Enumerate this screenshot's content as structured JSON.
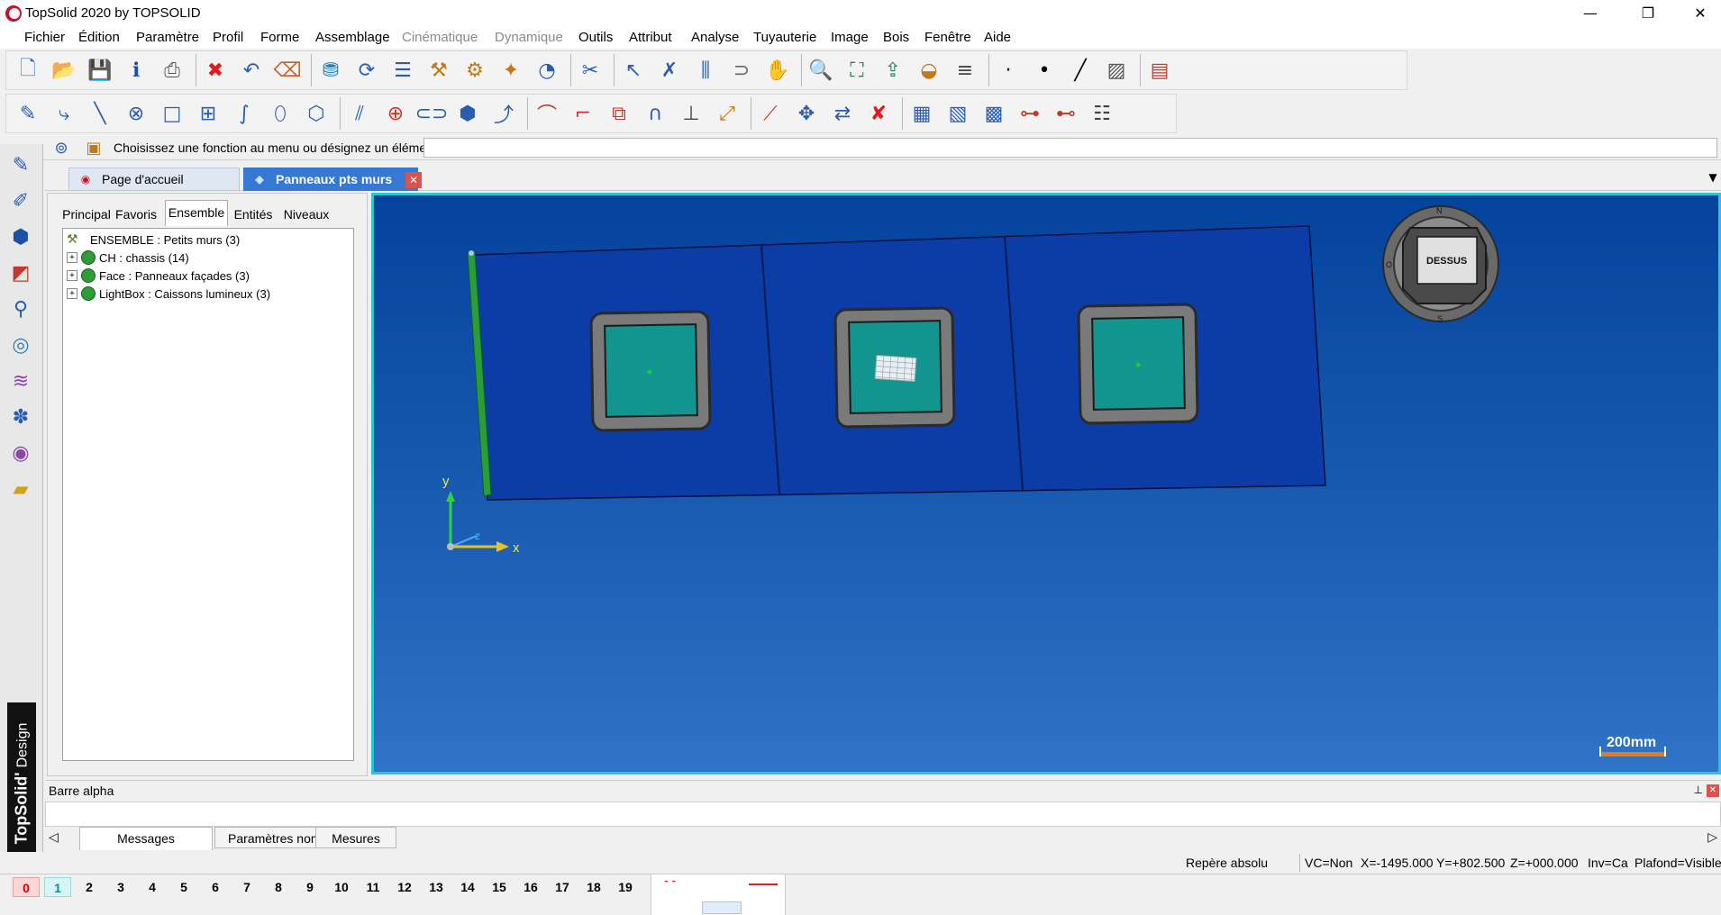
{
  "window": {
    "title": "TopSolid 2020 by TOPSOLID",
    "minimize_glyph": "—",
    "maximize_glyph": "❐",
    "close_glyph": "✕"
  },
  "menu": [
    {
      "label": "Fichier",
      "enabled": true
    },
    {
      "label": "Édition",
      "enabled": true
    },
    {
      "label": "Paramètre",
      "enabled": true
    },
    {
      "label": "Profil",
      "enabled": true
    },
    {
      "label": "Forme",
      "enabled": true
    },
    {
      "label": "Assemblage",
      "enabled": true
    },
    {
      "label": "Cinématique",
      "enabled": false
    },
    {
      "label": "Dynamique",
      "enabled": false
    },
    {
      "label": "Outils",
      "enabled": true
    },
    {
      "label": "Attribut",
      "enabled": true
    },
    {
      "label": "Analyse",
      "enabled": true
    },
    {
      "label": "Tuyauterie",
      "enabled": true
    },
    {
      "label": "Image",
      "enabled": true
    },
    {
      "label": "Bois",
      "enabled": true
    },
    {
      "label": "Fenêtre",
      "enabled": true
    },
    {
      "label": "Aide",
      "enabled": true
    }
  ],
  "toolbar1": {
    "icons": [
      {
        "name": "new-document-icon",
        "glyph": "🗋",
        "color": "#3a6fc4"
      },
      {
        "name": "open-folder-icon",
        "glyph": "📂",
        "color": "#d4a017"
      },
      {
        "name": "save-icon",
        "glyph": "💾",
        "color": "#2a4a8c"
      },
      {
        "name": "document-info-icon",
        "glyph": "ℹ",
        "color": "#1b4fa8"
      },
      {
        "name": "print-icon",
        "glyph": "⎙",
        "color": "#555555"
      },
      {
        "name": "delete-icon",
        "glyph": "✖",
        "color": "#e01b1b"
      },
      {
        "name": "undo-icon",
        "glyph": "↶",
        "color": "#2a5db0"
      },
      {
        "name": "eraser-icon",
        "glyph": "⌫",
        "color": "#c0622a"
      },
      {
        "name": "filter-icon",
        "glyph": "⛃",
        "color": "#2a7fbf"
      },
      {
        "name": "rotate-view-icon",
        "glyph": "⟳",
        "color": "#2a5db0"
      },
      {
        "name": "settings-sliders-icon",
        "glyph": "☰",
        "color": "#2a5db0"
      },
      {
        "name": "hammer-icon",
        "glyph": "⚒",
        "color": "#c07a1a"
      },
      {
        "name": "tools-icon",
        "glyph": "⚙",
        "color": "#c07a1a"
      },
      {
        "name": "magic-icon",
        "glyph": "✦",
        "color": "#c07a1a"
      },
      {
        "name": "measure-icon",
        "glyph": "◔",
        "color": "#2a5db0"
      },
      {
        "name": "snap-icon",
        "glyph": "✂",
        "color": "#2a5db0"
      },
      {
        "name": "select-arrow-icon",
        "glyph": "↖",
        "color": "#2a5db0"
      },
      {
        "name": "pick-icon",
        "glyph": "✗",
        "color": "#2a5db0"
      },
      {
        "name": "columns-icon",
        "glyph": "⫼",
        "color": "#2a5db0"
      },
      {
        "name": "magnet-icon",
        "glyph": "⊃",
        "color": "#666666"
      },
      {
        "name": "hand-icon",
        "glyph": "✋",
        "color": "#444444"
      },
      {
        "name": "zoom-icon",
        "glyph": "🔍",
        "color": "#2a5db0"
      },
      {
        "name": "fit-view-icon",
        "glyph": "⛶",
        "color": "#2a7f4f"
      },
      {
        "name": "export-icon",
        "glyph": "⇪",
        "color": "#2a7f4f"
      },
      {
        "name": "display-mode-icon",
        "glyph": "◒",
        "color": "#c07a1a"
      },
      {
        "name": "layer-icon",
        "glyph": "≡",
        "color": "#444444"
      },
      {
        "name": "dot-small-icon",
        "glyph": "·",
        "color": "#000000"
      },
      {
        "name": "dot-large-icon",
        "glyph": "•",
        "color": "#000000"
      },
      {
        "name": "line-icon",
        "glyph": "╱",
        "color": "#000000"
      },
      {
        "name": "hatch-icon",
        "glyph": "▨",
        "color": "#555555"
      },
      {
        "name": "screen-icon",
        "glyph": "▤",
        "color": "#c0392b"
      }
    ]
  },
  "toolbar2": {
    "icons": [
      {
        "name": "sketch-pencil-icon",
        "glyph": "✎",
        "color": "#2a5db0"
      },
      {
        "name": "polyline-icon",
        "glyph": "⤷",
        "color": "#2a5db0"
      },
      {
        "name": "line-tool-icon",
        "glyph": "╲",
        "color": "#2a5db0"
      },
      {
        "name": "circle-center-icon",
        "glyph": "⊗",
        "color": "#2a5db0"
      },
      {
        "name": "rectangle-icon",
        "glyph": "□",
        "color": "#2a5db0"
      },
      {
        "name": "frame-icon",
        "glyph": "⊞",
        "color": "#2a5db0"
      },
      {
        "name": "spline-icon",
        "glyph": "∫",
        "color": "#2a5db0"
      },
      {
        "name": "ellipse-icon",
        "glyph": "⬯",
        "color": "#2a5db0"
      },
      {
        "name": "polygon-icon",
        "glyph": "⬡",
        "color": "#2a5db0"
      },
      {
        "name": "parallel-icon",
        "glyph": "⫽",
        "color": "#2a5db0"
      },
      {
        "name": "point-icon",
        "glyph": "⊕",
        "color": "#c0392b"
      },
      {
        "name": "slot-icon",
        "glyph": "⊂⊃",
        "color": "#2a5db0"
      },
      {
        "name": "solid-box-icon",
        "glyph": "⬢",
        "color": "#2a5db0"
      },
      {
        "name": "sweep-icon",
        "glyph": "⤴",
        "color": "#2a5db0"
      },
      {
        "name": "fillet-icon",
        "glyph": "⌒",
        "color": "#c0392b"
      },
      {
        "name": "chamfer-icon",
        "glyph": "⌐",
        "color": "#c0392b"
      },
      {
        "name": "offset-icon",
        "glyph": "⧉",
        "color": "#c0392b"
      },
      {
        "name": "arc-icon",
        "glyph": "∩",
        "color": "#2a5db0"
      },
      {
        "name": "trim-icon",
        "glyph": "⊥",
        "color": "#444444"
      },
      {
        "name": "extend-icon",
        "glyph": "⤢",
        "color": "#c07a1a"
      },
      {
        "name": "dimension-icon",
        "glyph": "⟋",
        "color": "#c0392b"
      },
      {
        "name": "move-icon",
        "glyph": "✥",
        "color": "#2a5db0"
      },
      {
        "name": "mirror-icon",
        "glyph": "⇄",
        "color": "#2a5db0"
      },
      {
        "name": "cancel-icon",
        "glyph": "✘",
        "color": "#e01b1b"
      },
      {
        "name": "assembly-icon",
        "glyph": "▦",
        "color": "#2a5db0"
      },
      {
        "name": "part-icon",
        "glyph": "▧",
        "color": "#2a5db0"
      },
      {
        "name": "component-icon",
        "glyph": "▩",
        "color": "#2a5db0"
      },
      {
        "name": "tree-structure-icon",
        "glyph": "⊶",
        "color": "#c0392b"
      },
      {
        "name": "bom-icon",
        "glyph": "⊷",
        "color": "#c0392b"
      },
      {
        "name": "list-icon",
        "glyph": "☷",
        "color": "#444444"
      }
    ]
  },
  "command_line": {
    "prompt": "Choisissez une fonction au menu ou désignez un élément:",
    "value": ""
  },
  "left_tools": [
    {
      "name": "sketch-mode-icon",
      "glyph": "✎",
      "color": "#2a5db0"
    },
    {
      "name": "drafting-mode-icon",
      "glyph": "✐",
      "color": "#2a5db0"
    },
    {
      "name": "solid-mode-icon",
      "glyph": "⬢",
      "color": "#1b4fa8"
    },
    {
      "name": "surface-mode-icon",
      "glyph": "◩",
      "color": "#c0392b"
    },
    {
      "name": "tool-mode-icon",
      "glyph": "⚲",
      "color": "#2a5db0"
    },
    {
      "name": "target-mode-icon",
      "glyph": "◎",
      "color": "#2a7fbf"
    },
    {
      "name": "analysis-mode-icon",
      "glyph": "≋",
      "color": "#8e44ad"
    },
    {
      "name": "assembly-mode-icon",
      "glyph": "✽",
      "color": "#2a5db0"
    },
    {
      "name": "render-mode-icon",
      "glyph": "◉",
      "color": "#8e44ad"
    },
    {
      "name": "wood-mode-icon",
      "glyph": "▰",
      "color": "#d4a017"
    }
  ],
  "brand": {
    "top": "TopSolid",
    "bottom": "Design",
    "mark": "'"
  },
  "doc_tabs": [
    {
      "label": "Page d'accueil",
      "active": false
    },
    {
      "label": "Panneaux pts murs",
      "active": true
    }
  ],
  "tab_close": "✕",
  "panel": {
    "tabs": [
      "Principal",
      "Favoris",
      "Ensemble",
      "Entités",
      "Niveaux"
    ],
    "active_tab": 2,
    "tree": {
      "root": "ENSEMBLE : Petits murs (3)",
      "children": [
        {
          "label": "CH : chassis (14)",
          "expander": "+"
        },
        {
          "label": "Face : Panneaux façades (3)",
          "expander": "+"
        },
        {
          "label": "LightBox : Caissons lumineux (3)",
          "expander": "+"
        }
      ]
    }
  },
  "viewport": {
    "bg_top": "#04439d",
    "bg_bottom": "#2f74c6",
    "border_color": "#25c8d8",
    "compass": {
      "label": "DESSUS",
      "north": "N",
      "south": "S",
      "west": "O"
    },
    "axes": {
      "x": "x",
      "y": "y",
      "z": "z"
    },
    "scale": "200mm"
  },
  "alpha_bar": {
    "title": "Barre alpha",
    "pin": "⊥",
    "close": "✕"
  },
  "bottom_tabs": [
    "Messages",
    "Paramètres nommés",
    "Mesures"
  ],
  "bottom_scroll": {
    "left": "◁",
    "right": "▷"
  },
  "status": {
    "repere": "Repère absolu",
    "vc": "VC=Non",
    "x": "X=-1495.000",
    "y": "Y=+802.500",
    "z": "Z=+000.000",
    "inv": "Inv=Ca",
    "plafond": "Plafond=Visible"
  },
  "layers": [
    "0",
    "1",
    "2",
    "3",
    "4",
    "5",
    "6",
    "7",
    "8",
    "9",
    "10",
    "11",
    "12",
    "13",
    "14",
    "15",
    "16",
    "17",
    "18",
    "19"
  ],
  "line_styles": {
    "dashed": "- -",
    "solid": "——"
  }
}
